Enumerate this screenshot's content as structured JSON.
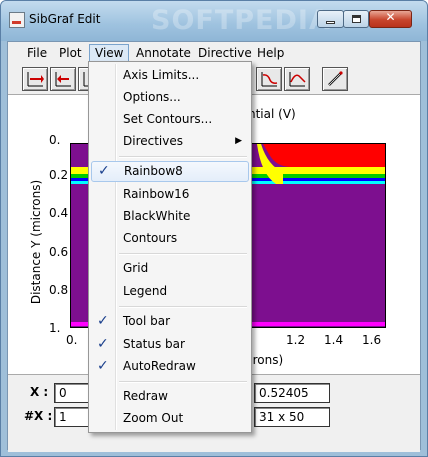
{
  "window": {
    "title": "SibGraf Edit",
    "watermark": "SOFTPEDIA",
    "close_glyph": "✕"
  },
  "menubar": {
    "items": [
      {
        "label": "File"
      },
      {
        "label": "Plot"
      },
      {
        "label": "View"
      },
      {
        "label": "Annotate"
      },
      {
        "label": "Directive"
      },
      {
        "label": "Help"
      }
    ]
  },
  "toolbar": {
    "buttons": [
      {
        "icon": "arrow-right-icon"
      },
      {
        "icon": "arrow-left-icon"
      },
      {
        "icon": "axis-icon"
      },
      {
        "icon": "plot-curve-icon"
      },
      {
        "icon": "plot-curve-icon"
      },
      {
        "icon": "pen-icon"
      }
    ]
  },
  "plot": {
    "title_visible": "ntial (V)",
    "ylabel": "Distance Y (microns)",
    "xlabel_visible": "crons)",
    "yticks": [
      "0.",
      "0.2",
      "0.4",
      "0.6",
      "0.8",
      "1."
    ],
    "xticks": [
      "0.",
      "1.2",
      "1.4",
      "1.6"
    ],
    "band_colors": [
      "#ff0000",
      "#ffff00",
      "#00cc00",
      "#0000ff",
      "#00ffff",
      "#7d0f8f",
      "#ff00ff"
    ]
  },
  "status": {
    "x_label": "X :",
    "x_value": "0",
    "nx_label": "#X :",
    "nx_value": "1",
    "value_field": "0.52405",
    "grid_field": "31 x 50"
  },
  "view_menu": {
    "items": [
      {
        "label": "Axis Limits...",
        "checked": false
      },
      {
        "label": "Options...",
        "checked": false
      },
      {
        "label": "Set Contours...",
        "checked": false
      },
      {
        "label": "Directives",
        "checked": false,
        "submenu": true
      },
      {
        "label": "Rainbow8",
        "checked": true,
        "highlighted": true
      },
      {
        "label": "Rainbow16",
        "checked": false
      },
      {
        "label": "BlackWhite",
        "checked": false
      },
      {
        "label": "Contours",
        "checked": false
      },
      {
        "label": "Grid",
        "checked": false
      },
      {
        "label": "Legend",
        "checked": false
      },
      {
        "label": "Tool bar",
        "checked": true
      },
      {
        "label": "Status bar",
        "checked": true
      },
      {
        "label": "AutoRedraw",
        "checked": true
      },
      {
        "label": "Redraw",
        "checked": false
      },
      {
        "label": "Zoom Out",
        "checked": false
      }
    ],
    "check_glyph": "✓",
    "submenu_glyph": "▶"
  }
}
